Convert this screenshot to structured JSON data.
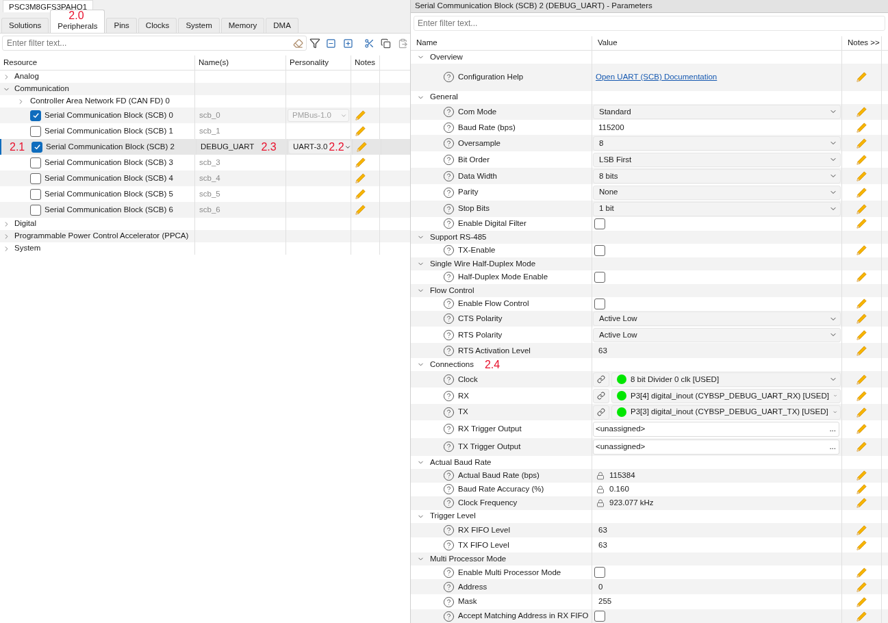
{
  "device_tab": {
    "label": "PSC3M8GFS3PAHQ1"
  },
  "tabs": [
    {
      "label": "Solutions",
      "selected": false
    },
    {
      "label": "Peripherals",
      "selected": true,
      "annotation": "2.0"
    },
    {
      "label": "Pins",
      "selected": false
    },
    {
      "label": "Clocks",
      "selected": false
    },
    {
      "label": "System",
      "selected": false
    },
    {
      "label": "Memory",
      "selected": false
    },
    {
      "label": "DMA",
      "selected": false
    }
  ],
  "filter": {
    "placeholder": "Enter filter text..."
  },
  "resource_table": {
    "columns": [
      "Resource",
      "Name(s)",
      "Personality",
      "Notes"
    ],
    "rows": [
      {
        "label": "Analog",
        "expanded": false
      },
      {
        "label": "Communication",
        "expanded": true,
        "children": [
          {
            "kind": "folder",
            "label": "Controller Area Network FD (CAN FD) 0",
            "expanded": false
          },
          {
            "kind": "block",
            "label": "Serial Communication Block (SCB) 0",
            "checked": true,
            "selected": false,
            "name": "scb_0",
            "default_name": true,
            "personality": "PMBus-1.0",
            "personality_disabled": true
          },
          {
            "kind": "block",
            "label": "Serial Communication Block (SCB) 1",
            "checked": false,
            "selected": false,
            "name": "scb_1",
            "default_name": true
          },
          {
            "kind": "block",
            "label": "Serial Communication Block (SCB) 2",
            "checked": true,
            "selected": true,
            "annotation": "2.1",
            "name": "DEBUG_UART",
            "default_name": false,
            "name_annotation": "2.3",
            "personality": "UART-3.0",
            "personality_disabled": false,
            "personality_annotation": "2.2"
          },
          {
            "kind": "block",
            "label": "Serial Communication Block (SCB) 3",
            "checked": false,
            "selected": false,
            "name": "scb_3",
            "default_name": true
          },
          {
            "kind": "block",
            "label": "Serial Communication Block (SCB) 4",
            "checked": false,
            "selected": false,
            "name": "scb_4",
            "default_name": true
          },
          {
            "kind": "block",
            "label": "Serial Communication Block (SCB) 5",
            "checked": false,
            "selected": false,
            "name": "scb_5",
            "default_name": true
          },
          {
            "kind": "block",
            "label": "Serial Communication Block (SCB) 6",
            "checked": false,
            "selected": false,
            "name": "scb_6",
            "default_name": true
          }
        ]
      },
      {
        "label": "Digital",
        "expanded": false
      },
      {
        "label": "Programmable Power Control Accelerator (PPCA)",
        "expanded": false
      },
      {
        "label": "System",
        "expanded": false
      }
    ]
  },
  "parameters": {
    "title": "Serial Communication Block (SCB) 2 (DEBUG_UART) - Parameters",
    "filter": {
      "placeholder": "Enter filter text..."
    },
    "columns": [
      "Name",
      "Value",
      "Notes >>"
    ],
    "groups": [
      {
        "label": "Overview",
        "expanded": true,
        "rows": [
          {
            "label": "Configuration Help",
            "kind": "link",
            "value": "Open UART (SCB) Documentation"
          }
        ]
      },
      {
        "label": "General",
        "expanded": true,
        "rows": [
          {
            "label": "Com Mode",
            "kind": "dropdown",
            "value": "Standard"
          },
          {
            "label": "Baud Rate (bps)",
            "kind": "text",
            "value": "115200"
          },
          {
            "label": "Oversample",
            "kind": "dropdown",
            "value": "8"
          },
          {
            "label": "Bit Order",
            "kind": "dropdown",
            "value": "LSB First"
          },
          {
            "label": "Data Width",
            "kind": "dropdown",
            "value": "8 bits"
          },
          {
            "label": "Parity",
            "kind": "dropdown",
            "value": "None"
          },
          {
            "label": "Stop Bits",
            "kind": "dropdown",
            "value": "1 bit"
          },
          {
            "label": "Enable Digital Filter",
            "kind": "checkbox",
            "checked": false
          }
        ]
      },
      {
        "label": "Support RS-485",
        "expanded": true,
        "rows": [
          {
            "label": "TX-Enable",
            "kind": "checkbox",
            "checked": false
          }
        ]
      },
      {
        "label": "Single Wire Half-Duplex Mode",
        "expanded": true,
        "rows": [
          {
            "label": "Half-Duplex Mode Enable",
            "kind": "checkbox",
            "checked": false
          }
        ]
      },
      {
        "label": "Flow Control",
        "expanded": true,
        "rows": [
          {
            "label": "Enable Flow Control",
            "kind": "checkbox",
            "checked": false
          },
          {
            "label": "CTS Polarity",
            "kind": "dropdown",
            "value": "Active Low"
          },
          {
            "label": "RTS Polarity",
            "kind": "dropdown",
            "value": "Active Low"
          },
          {
            "label": "RTS Activation Level",
            "kind": "text",
            "value": "63"
          }
        ]
      },
      {
        "label": "Connections",
        "expanded": true,
        "annotation": "2.4",
        "rows": [
          {
            "label": "Clock",
            "kind": "connection",
            "value": "8 bit Divider 0 clk [USED]",
            "color": "#00e600"
          },
          {
            "label": "RX",
            "kind": "connection",
            "value": "P3[4] digital_inout (CYBSP_DEBUG_UART_RX) [USED]",
            "color": "#00e600"
          },
          {
            "label": "TX",
            "kind": "connection",
            "value": "P3[3] digital_inout (CYBSP_DEBUG_UART_TX) [USED]",
            "color": "#00e600"
          },
          {
            "label": "RX Trigger Output",
            "kind": "picker",
            "value": "<unassigned>",
            "button": "..."
          },
          {
            "label": "TX Trigger Output",
            "kind": "picker",
            "value": "<unassigned>",
            "button": "..."
          }
        ]
      },
      {
        "label": "Actual Baud Rate",
        "expanded": true,
        "rows": [
          {
            "label": "Actual Baud Rate (bps)",
            "kind": "locked",
            "value": "115384"
          },
          {
            "label": "Baud Rate Accuracy (%)",
            "kind": "locked",
            "value": "0.160"
          },
          {
            "label": "Clock Frequency",
            "kind": "locked",
            "value": "923.077 kHz"
          }
        ]
      },
      {
        "label": "Trigger Level",
        "expanded": true,
        "rows": [
          {
            "label": "RX FIFO Level",
            "kind": "text",
            "value": "63"
          },
          {
            "label": "TX FIFO Level",
            "kind": "text",
            "value": "63"
          }
        ]
      },
      {
        "label": "Multi Processor Mode",
        "expanded": true,
        "rows": [
          {
            "label": "Enable Multi Processor Mode",
            "kind": "checkbox",
            "checked": false
          },
          {
            "label": "Address",
            "kind": "text",
            "value": "0"
          },
          {
            "label": "Mask",
            "kind": "text",
            "value": "255"
          },
          {
            "label": "Accept Matching Address in RX FIFO",
            "kind": "checkbox",
            "checked": false
          }
        ]
      }
    ]
  }
}
